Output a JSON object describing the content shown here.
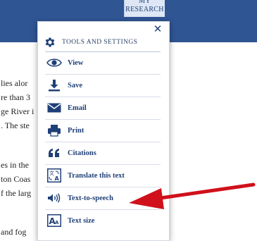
{
  "header": {
    "my_research_line1": "MY",
    "my_research_line2": "RESEARCH"
  },
  "background_text": [
    "lies alor",
    "re than 3",
    "ge River i",
    ". The ste",
    "es in the",
    "ton Coas",
    "f the larg",
    "and fog"
  ],
  "panel": {
    "title": "TOOLS AND SETTINGS",
    "close_symbol": "✕",
    "items": [
      {
        "label": "View",
        "icon": "eye-icon"
      },
      {
        "label": "Save",
        "icon": "download-icon"
      },
      {
        "label": "Email",
        "icon": "envelope-icon"
      },
      {
        "label": "Print",
        "icon": "printer-icon"
      },
      {
        "label": "Citations",
        "icon": "quote-icon"
      },
      {
        "label": "Translate this text",
        "icon": "translate-icon"
      },
      {
        "label": "Text-to-speech",
        "icon": "speaker-icon"
      },
      {
        "label": "Text size",
        "icon": "text-size-icon"
      }
    ]
  },
  "colors": {
    "header_blue": "#2f5593",
    "accent_navy": "#1f3f77",
    "arrow_red": "#d0101a"
  }
}
